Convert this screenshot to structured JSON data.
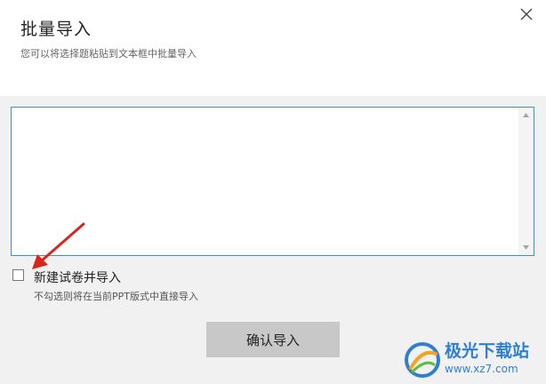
{
  "dialog": {
    "title": "批量导入",
    "subtitle": "您可以将选择题粘贴到文本框中批量导入"
  },
  "import_box": {
    "value": "",
    "placeholder": ""
  },
  "options": {
    "new_paper_label": "新建试卷并导入",
    "new_paper_checked": false,
    "hint": "不勾选则将在当前PPT版式中直接导入"
  },
  "actions": {
    "confirm_label": "确认导入"
  },
  "watermark": {
    "name": "极光下载站",
    "url": "www.xz7.com"
  },
  "icons": {
    "close": "close-icon",
    "arrow": "red-arrow-icon",
    "logo": "aurora-logo-icon"
  },
  "colors": {
    "accent_border": "#3a93c7",
    "button_bg": "#c8c8c8",
    "annotation_arrow": "#d9261c",
    "watermark_blue": "#2f7fd0"
  }
}
